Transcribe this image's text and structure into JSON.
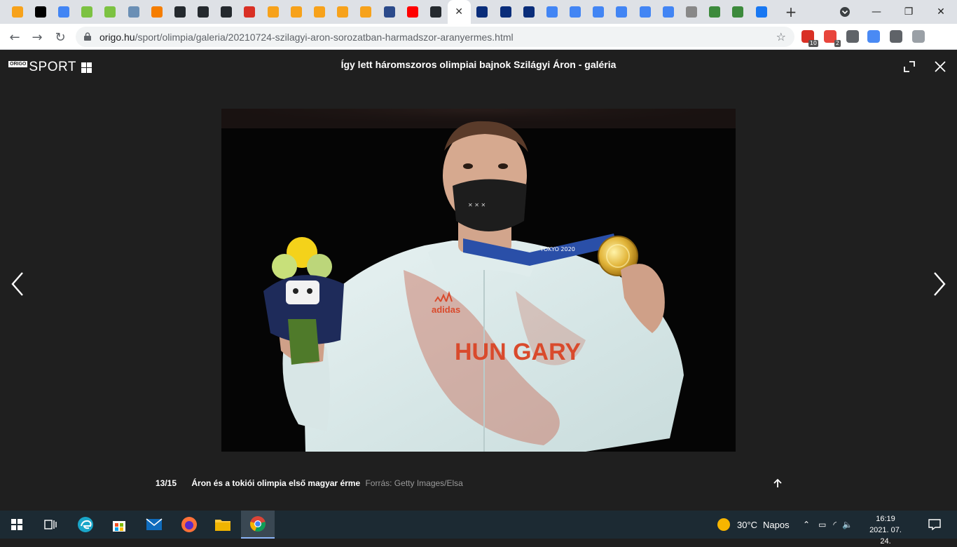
{
  "browser": {
    "tabs": [
      {
        "icon": "origo-icon",
        "color": "#f7a21b"
      },
      {
        "icon": "medium-icon",
        "color": "#000000"
      },
      {
        "icon": "google-icon",
        "color": "#4285f4"
      },
      {
        "icon": "smiley-icon",
        "color": "#7cc242"
      },
      {
        "icon": "smiley-icon",
        "color": "#7cc242"
      },
      {
        "icon": "ship-icon",
        "color": "#6b8fb5"
      },
      {
        "icon": "blogger-icon",
        "color": "#f57d00"
      },
      {
        "icon": "github-icon",
        "color": "#24292e"
      },
      {
        "icon": "github-icon",
        "color": "#24292e"
      },
      {
        "icon": "github-icon",
        "color": "#24292e"
      },
      {
        "icon": "infinity-icon",
        "color": "#d93025"
      },
      {
        "icon": "origo-icon",
        "color": "#f7a21b"
      },
      {
        "icon": "origo-icon",
        "color": "#f7a21b"
      },
      {
        "icon": "origo-icon",
        "color": "#f7a21b"
      },
      {
        "icon": "origo-icon",
        "color": "#f7a21b"
      },
      {
        "icon": "origo-icon",
        "color": "#f7a21b"
      },
      {
        "icon": "globe-icon",
        "color": "#2b4a8b"
      },
      {
        "icon": "youtube-icon",
        "color": "#ff0000"
      },
      {
        "icon": "github-icon",
        "color": "#24292e"
      },
      {
        "icon": "close-icon",
        "color": "#333333",
        "active": true
      },
      {
        "icon": "o-icon",
        "color": "#0a2d7a"
      },
      {
        "icon": "o-icon",
        "color": "#0a2d7a"
      },
      {
        "icon": "o-icon",
        "color": "#0a2d7a"
      },
      {
        "icon": "google-icon",
        "color": "#4285f4"
      },
      {
        "icon": "google-icon",
        "color": "#4285f4"
      },
      {
        "icon": "google-icon",
        "color": "#4285f4"
      },
      {
        "icon": "google-icon",
        "color": "#4285f4"
      },
      {
        "icon": "google-icon",
        "color": "#4285f4"
      },
      {
        "icon": "google-icon",
        "color": "#4285f4"
      },
      {
        "icon": "globe-icon",
        "color": "#888888"
      },
      {
        "icon": "landscape-icon",
        "color": "#3c8a3c"
      },
      {
        "icon": "landscape-icon",
        "color": "#3c8a3c"
      },
      {
        "icon": "facebook-icon",
        "color": "#1877f2"
      }
    ],
    "new_tab_label": "+",
    "url_host": "origo.hu",
    "url_path": "/sport/olimpia/galeria/20210724-szilagyi-aron-sorozatban-harmadszor-aranyermes.html",
    "extensions": [
      {
        "icon": "pdf-icon",
        "badge": "10",
        "color": "#d93025"
      },
      {
        "icon": "adblock-icon",
        "badge": "2",
        "color": "#e8453c"
      },
      {
        "icon": "extension-puzzle-gray-icon",
        "badge": "",
        "color": "#5f6368"
      },
      {
        "icon": "document-icon",
        "badge": "",
        "color": "#4a8af4"
      },
      {
        "icon": "extension-puzzle-icon",
        "badge": "",
        "color": "#5f6368"
      },
      {
        "icon": "profile-icon",
        "badge": "",
        "color": "#9aa0a6"
      }
    ]
  },
  "gallery": {
    "brand_small": "ORIGO",
    "brand": "SPORT",
    "title": "Így lett háromszoros olimpiai bajnok Szilágyi Áron - galéria",
    "counter": "13/15",
    "caption": "Áron és a tokiói olimpia első magyar érme",
    "source": "Forrás: Getty Images/Elsa",
    "photo_text_jersey": "HUN GARY",
    "photo_text_brand": "adidas",
    "photo_text_ribbon": "TOKYO 2020"
  },
  "taskbar": {
    "weather_temp": "30°C",
    "weather_desc": "Napos",
    "time": "16:19",
    "date": "2021. 07. 24."
  }
}
